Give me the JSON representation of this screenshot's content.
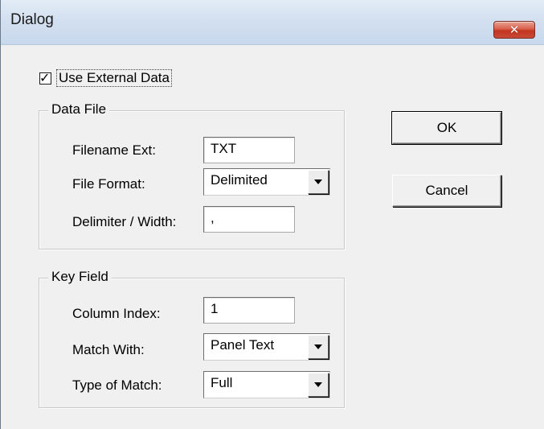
{
  "window": {
    "title": "Dialog",
    "close_glyph": "✕"
  },
  "use_external": {
    "label": "Use External Data",
    "checked": true,
    "check_glyph": "✓"
  },
  "data_file": {
    "label": "Data File",
    "filename_ext": {
      "label": "Filename Ext:",
      "value": "TXT"
    },
    "file_format": {
      "label": "File Format:",
      "value": "Delimited"
    },
    "delimiter": {
      "label": "Delimiter / Width:",
      "value": ","
    }
  },
  "key_field": {
    "label": "Key Field",
    "column_index": {
      "label": "Column Index:",
      "value": "1"
    },
    "match_with": {
      "label": "Match With:",
      "value": "Panel Text"
    },
    "type_of_match": {
      "label": "Type of Match:",
      "value": "Full"
    }
  },
  "buttons": {
    "ok": "OK",
    "cancel": "Cancel"
  },
  "colors": {
    "close_button": "#c84a37",
    "titlebar": "#d3e0f0",
    "face": "#f0f0f0"
  }
}
